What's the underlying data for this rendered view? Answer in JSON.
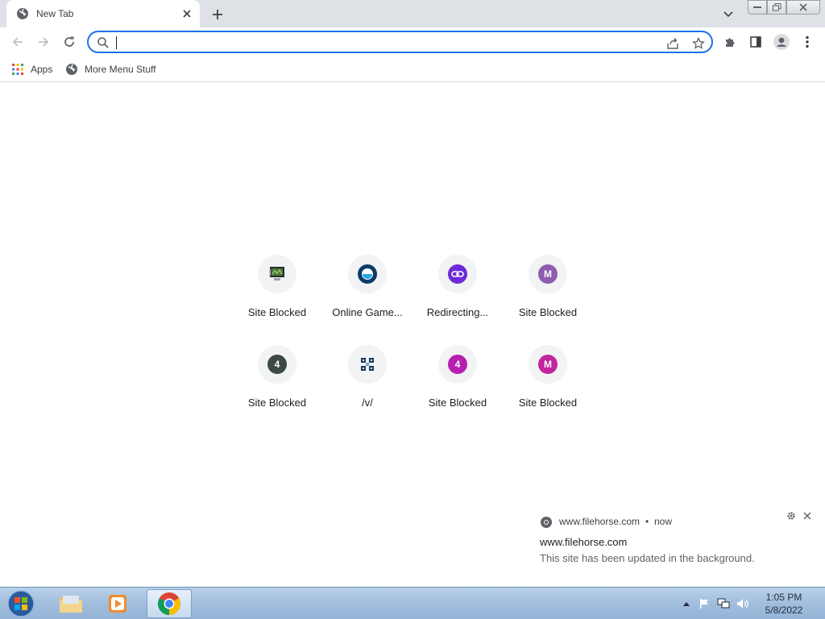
{
  "tab": {
    "title": "New Tab"
  },
  "omnibox": {
    "value": "",
    "placeholder": ""
  },
  "bookmarks": [
    {
      "label": "Apps",
      "icon": "apps-grid-icon"
    },
    {
      "label": "More Menu Stuff",
      "icon": "globe-icon"
    }
  ],
  "shortcuts": [
    {
      "label": "Site Blocked",
      "icon": "computer-icon",
      "bg": "#f1f3f4",
      "letter": ""
    },
    {
      "label": "Online Game...",
      "icon": "game-ring-icon",
      "bg": "#0d3b66",
      "letter": ""
    },
    {
      "label": "Redirecting...",
      "icon": "link-icon",
      "bg": "#6c2bd9",
      "letter": ""
    },
    {
      "label": "Site Blocked",
      "icon": "letter-icon",
      "bg": "#8e5cb0",
      "letter": "M"
    },
    {
      "label": "Site Blocked",
      "icon": "letter-icon",
      "bg": "#3d4a44",
      "letter": "4"
    },
    {
      "label": "/v/",
      "icon": "clover-icon",
      "bg": "#f1f3f4",
      "letter": ""
    },
    {
      "label": "Site Blocked",
      "icon": "letter-icon",
      "bg": "#b620b0",
      "letter": "4"
    },
    {
      "label": "Site Blocked",
      "icon": "letter-icon",
      "bg": "#c2269e",
      "letter": "M"
    }
  ],
  "notification": {
    "source": "www.filehorse.com",
    "separator": "•",
    "time": "now",
    "title": "www.filehorse.com",
    "body": "This site has been updated in the background."
  },
  "taskbar": {
    "clock_time": "1:05 PM",
    "clock_date": "5/8/2022"
  },
  "colors": {
    "accent": "#1a73e8",
    "tabstrip": "#dee1e6"
  }
}
